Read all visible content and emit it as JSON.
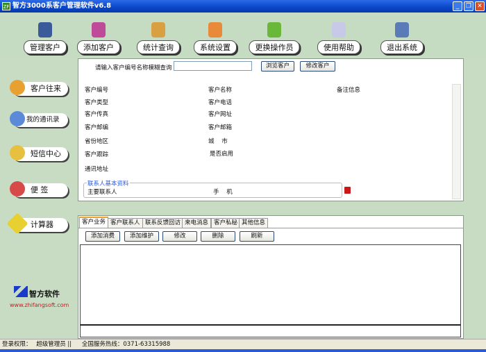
{
  "window": {
    "title": "智方3000系客户管理软件v6.8",
    "icon_text": "ZF"
  },
  "toolbar": [
    "管理客户",
    "添加客户",
    "统计查询",
    "系统设置",
    "更换操作员",
    "使用帮助",
    "退出系统"
  ],
  "sidebar": [
    "客户往来",
    "我的通讯录",
    "短信中心",
    "便 签",
    "计算器"
  ],
  "logo": {
    "name": "智方软件",
    "url": "www.zhifangsoft.com"
  },
  "search": {
    "label": "请输入客户编号名称模糊查询",
    "value": "",
    "browse": "浏览客户",
    "edit": "修改客户"
  },
  "fields": {
    "col1": [
      "客户编号",
      "客户类型",
      "客户传真",
      "客户邮编",
      "省份地区",
      "客户跟踪",
      "通讯地址"
    ],
    "col2": [
      "客户名称",
      "客户电话",
      "客户网址",
      "客户邮箱",
      "城    市",
      "是否启用"
    ],
    "remark": "备注信息"
  },
  "contact": {
    "legend": "联系人基本资料",
    "primary": "主要联系人",
    "mobile": "手    机"
  },
  "tabs": [
    "客户业务",
    "客户联系人",
    "联系反馈回访",
    "来电消息",
    "客户私秘",
    "其他信息"
  ],
  "actions": [
    "添加消费",
    "添加维护",
    "修改",
    "删除",
    "刷新"
  ],
  "status": {
    "login_label": "登录权限：",
    "role": "超级管理员 ||",
    "hotline": "全国服务热线：0371-63315988"
  }
}
